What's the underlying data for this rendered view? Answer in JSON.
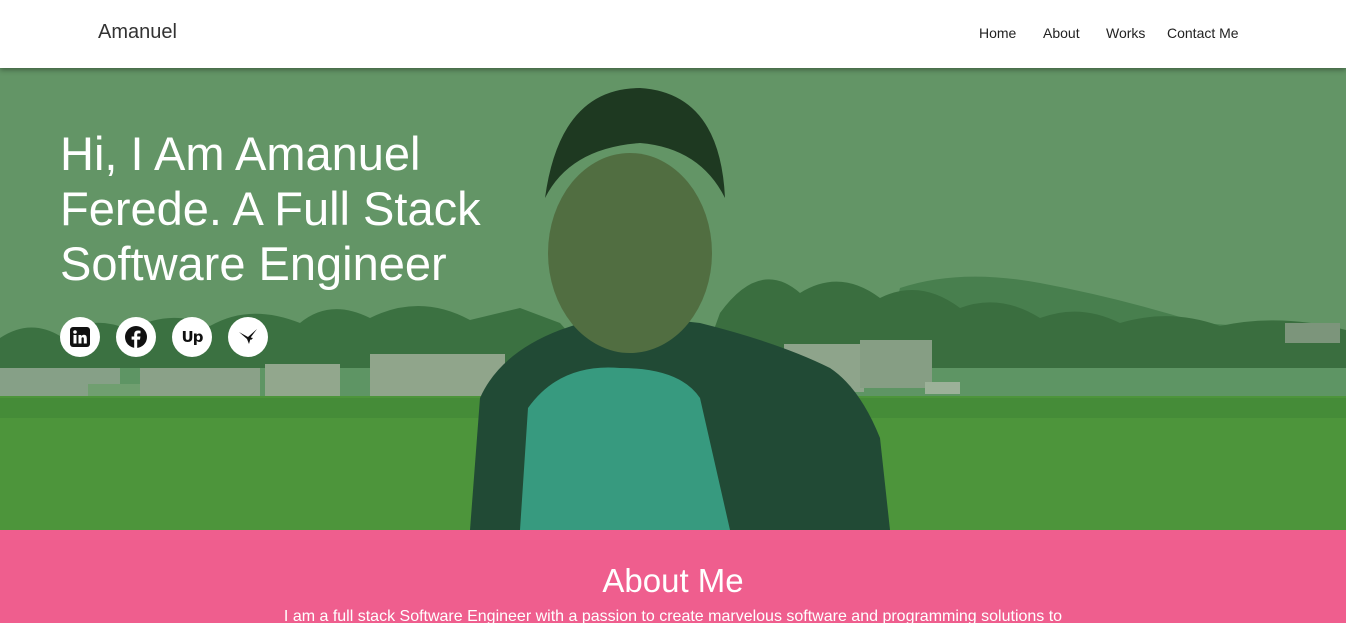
{
  "header": {
    "brand": "Amanuel",
    "nav": {
      "home": "Home",
      "about": "About",
      "works": "Works",
      "contact": "Contact Me"
    }
  },
  "hero": {
    "title": "Hi, I Am Amanuel Ferede. A Full Stack Software Engineer",
    "overlay_color": "#2e7d32",
    "socials": [
      {
        "icon": "linkedin-icon"
      },
      {
        "icon": "facebook-icon"
      },
      {
        "icon": "upwork-icon",
        "glyph": "Up"
      },
      {
        "icon": "hummingbird-icon"
      }
    ]
  },
  "about": {
    "title": "About Me",
    "text": "I am a full stack Software Engineer with a passion to create marvelous software and programming solutions to",
    "background": "#ef5e8e"
  }
}
